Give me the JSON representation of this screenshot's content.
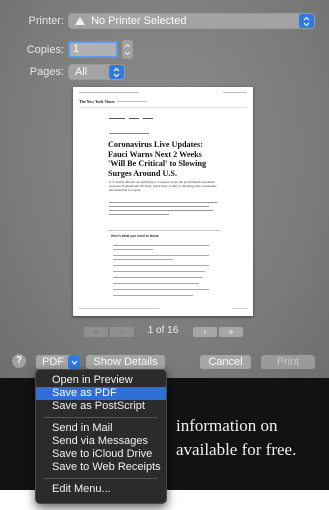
{
  "printer": {
    "label": "Printer:",
    "value": "No Printer Selected",
    "warning_icon": "warning-icon"
  },
  "copies": {
    "label": "Copies:",
    "value": "1"
  },
  "pages": {
    "label": "Pages:",
    "value": "All"
  },
  "preview": {
    "site_header": "The New York Times",
    "headline": "Coronavirus Live Updates: Fauci Warns Next 2 Weeks 'Will Be Critical' to Slowing Surges Around U.S.",
    "body": "U.S. health officials are testifying to Congress about the government's pandemic response. England will lift many restrictions on July 4, allowing pubs, restaurants and museums to reopen.",
    "section_title": "Here's what you need to know:"
  },
  "pager": {
    "first": "«",
    "prev": "‹",
    "next": "›",
    "last": "»",
    "page_status": "1 of 16"
  },
  "buttons": {
    "help": "?",
    "pdf": "PDF",
    "show_details": "Show Details",
    "cancel": "Cancel",
    "print": "Print"
  },
  "pdf_menu": {
    "items": [
      "Open in Preview",
      "Save as PDF",
      "Save as PostScript",
      "Send in Mail",
      "Send via Messages",
      "Save to iCloud Drive",
      "Save to Web Receipts",
      "Edit Menu..."
    ],
    "selected": "Save as PDF"
  },
  "background_text": {
    "line1": "information on",
    "line2": "available for free."
  },
  "colors": {
    "accent": "#2f7ae0",
    "menu_bg": "#2b2b2b",
    "menu_selected": "#2f6fd6"
  }
}
